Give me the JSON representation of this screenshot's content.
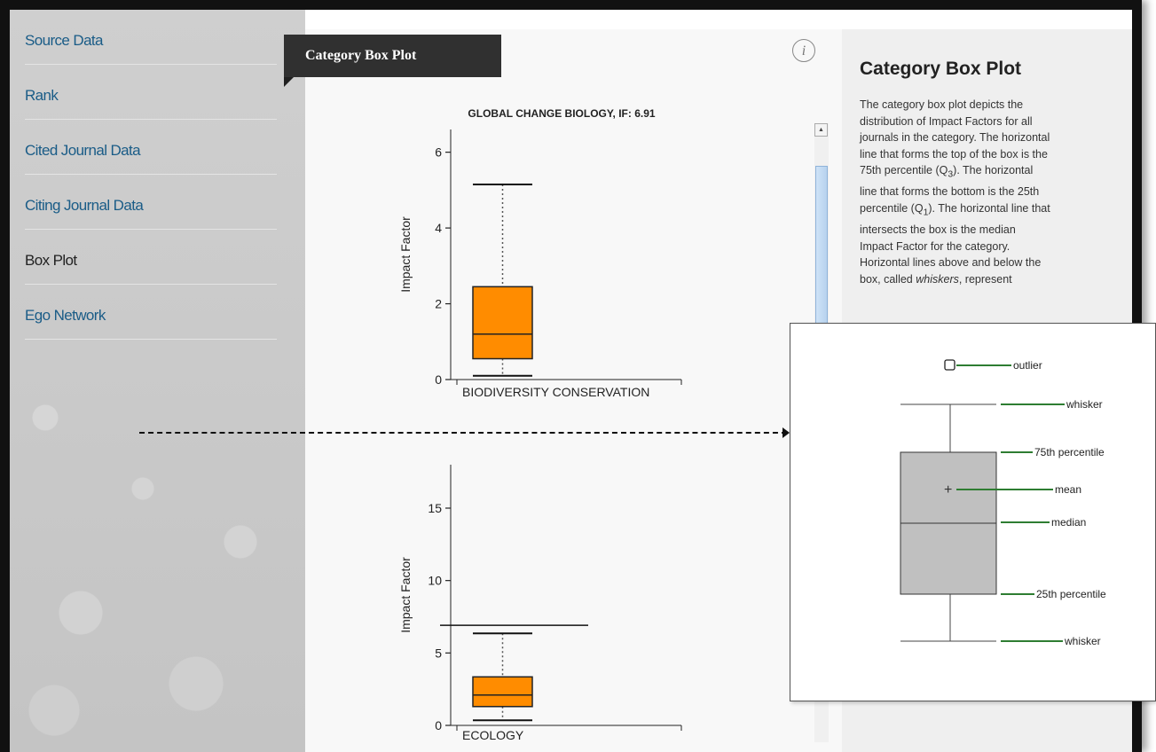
{
  "sidebar": {
    "items": [
      {
        "label": "Source Data",
        "active": false
      },
      {
        "label": "Rank",
        "active": false
      },
      {
        "label": "Cited Journal Data",
        "active": false
      },
      {
        "label": "Citing Journal Data",
        "active": false
      },
      {
        "label": "Box Plot",
        "active": true
      },
      {
        "label": "Ego Network",
        "active": false
      }
    ]
  },
  "panel": {
    "tab_title": "Category Box Plot",
    "info_icon_glyph": "i"
  },
  "chart_data": [
    {
      "type": "box",
      "title": "GLOBAL CHANGE BIOLOGY, IF: 6.91",
      "ylabel": "Impact Factor",
      "ylim": [
        0,
        6.6
      ],
      "yticks": [
        0,
        2,
        4,
        6
      ],
      "categories": [
        "BIODIVERSITY CONSERVATION"
      ],
      "box": {
        "whisker_low": 0.1,
        "q1": 0.55,
        "median": 1.2,
        "q3": 2.45,
        "whisker_high": 5.15
      },
      "journal_line": null,
      "color": "#ff8c00"
    },
    {
      "type": "box",
      "title": "",
      "ylabel": "Impact Factor",
      "ylim": [
        0,
        18
      ],
      "yticks": [
        0,
        5,
        10,
        15
      ],
      "categories": [
        "ECOLOGY"
      ],
      "box": {
        "whisker_low": 0.35,
        "q1": 1.3,
        "median": 2.1,
        "q3": 3.35,
        "whisker_high": 6.35
      },
      "journal_line": 6.91,
      "color": "#ff8c00"
    }
  ],
  "description": {
    "title": "Category Box Plot",
    "lines": [
      "The category box plot depicts the",
      "distribution of Impact Factors for all",
      "journals in the category. The horizontal",
      "line that forms the top of the box is the",
      "75th percentile (Q3). The horizontal",
      "line that forms the bottom is the 25th",
      "percentile (Q1). The horizontal line that",
      "intersects the box is the median",
      "Impact Factor for the category.",
      "Horizontal lines above and below the",
      "box, called whiskers, represent"
    ]
  },
  "legend": {
    "outlier": "outlier",
    "whisker_top": "whisker",
    "p75": "75th  percentile",
    "mean": "mean",
    "median": "median",
    "p25": "25th percentile",
    "whisker_bottom": "whisker"
  },
  "colors": {
    "box_fill": "#ff8c00",
    "nav_link": "#1a5c87",
    "legend_leader": "#2e7d32",
    "legend_box": "#c0c0c0"
  }
}
